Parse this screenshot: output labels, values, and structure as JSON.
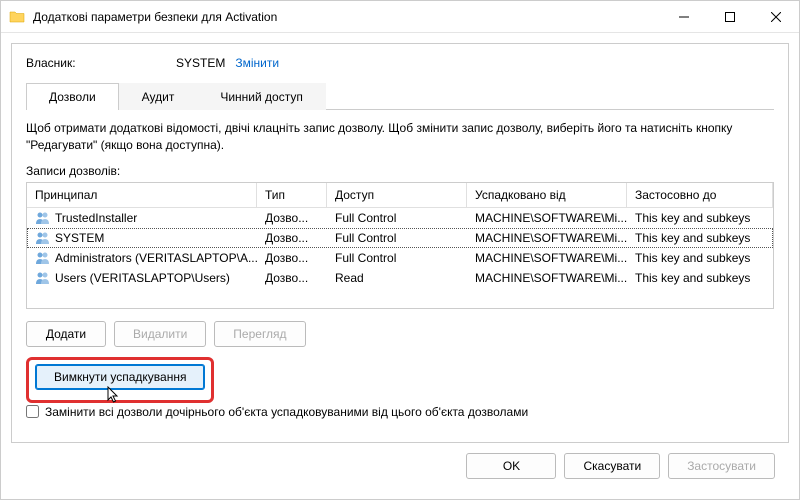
{
  "titlebar": {
    "title": "Додаткові параметри безпеки для Activation"
  },
  "owner": {
    "label": "Власник:",
    "value": "SYSTEM",
    "change_link": "Змінити"
  },
  "tabs": {
    "permissions": "Дозволи",
    "audit": "Аудит",
    "effective": "Чинний доступ"
  },
  "description": "Щоб отримати додаткові відомості, двічі клацніть запис дозволу. Щоб змінити запис дозволу, виберіть його та натисніть кнопку \"Редагувати\" (якщо вона доступна).",
  "entries_label": "Записи дозволів:",
  "columns": {
    "principal": "Принципал",
    "type": "Тип",
    "access": "Доступ",
    "inherited": "Успадковано від",
    "applies": "Застосовно до"
  },
  "rows": [
    {
      "principal": "TrustedInstaller",
      "type": "Дозво...",
      "access": "Full Control",
      "inherited": "MACHINE\\SOFTWARE\\Mi...",
      "applies": "This key and subkeys"
    },
    {
      "principal": "SYSTEM",
      "type": "Дозво...",
      "access": "Full Control",
      "inherited": "MACHINE\\SOFTWARE\\Mi...",
      "applies": "This key and subkeys"
    },
    {
      "principal": "Administrators (VERITASLAPTOP\\A...",
      "type": "Дозво...",
      "access": "Full Control",
      "inherited": "MACHINE\\SOFTWARE\\Mi...",
      "applies": "This key and subkeys"
    },
    {
      "principal": "Users (VERITASLAPTOP\\Users)",
      "type": "Дозво...",
      "access": "Read",
      "inherited": "MACHINE\\SOFTWARE\\Mi...",
      "applies": "This key and subkeys"
    }
  ],
  "buttons": {
    "add": "Додати",
    "remove": "Видалити",
    "view": "Перегляд",
    "disable_inherit": "Вимкнути успадкування"
  },
  "checkbox": {
    "label": "Замінити всі дозволи дочірнього об'єкта успадковуваними від цього об'єкта дозволами"
  },
  "footer": {
    "ok": "OK",
    "cancel": "Скасувати",
    "apply": "Застосувати"
  }
}
